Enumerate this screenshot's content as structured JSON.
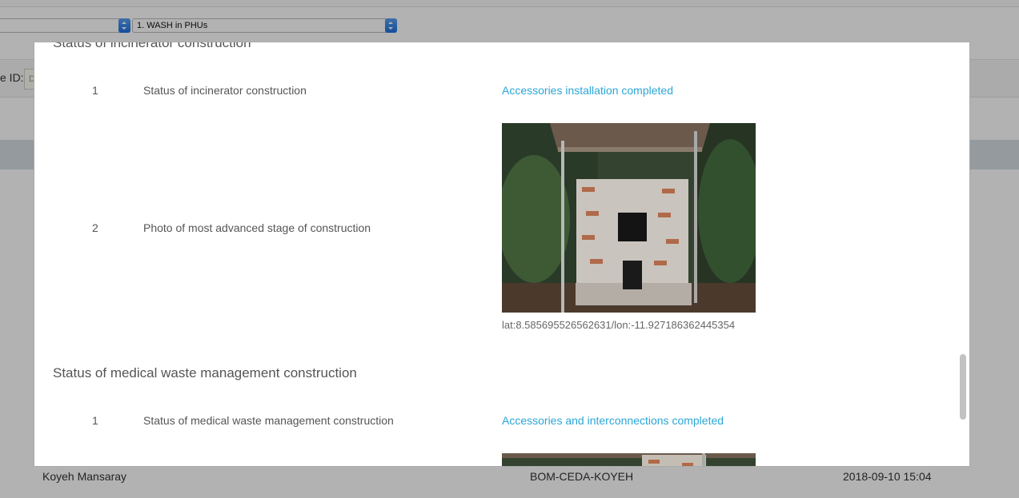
{
  "background": {
    "form_select_value": "1. WASH in PHUs",
    "id_label": "e ID:",
    "id_field_value": "D",
    "footer": {
      "name": "Koyeh Mansaray",
      "code": "BOM-CEDA-KOYEH",
      "datetime": "2018-09-10 15:04"
    }
  },
  "modal": {
    "sections": [
      {
        "title": "Status of incinerator construction",
        "rows": [
          {
            "num": "1",
            "question": "Status of incinerator construction",
            "answer": "Accessories installation completed"
          },
          {
            "num": "2",
            "question": "Photo of most advanced stage of construction",
            "photo_icon": "incinerator-photo",
            "geo": "lat:8.585695526562631/lon:-11.927186362445354"
          }
        ]
      },
      {
        "title": "Status of medical waste management construction",
        "rows": [
          {
            "num": "1",
            "question": "Status of medical waste management construction",
            "answer": "Accessories and interconnections completed"
          },
          {
            "photo_icon": "waste-management-photo"
          }
        ]
      }
    ]
  },
  "colors": {
    "answer_link": "#2ba6d6",
    "overlay": "rgba(0,0,0,0.30)",
    "select_stepper": "#1d6fe0"
  }
}
